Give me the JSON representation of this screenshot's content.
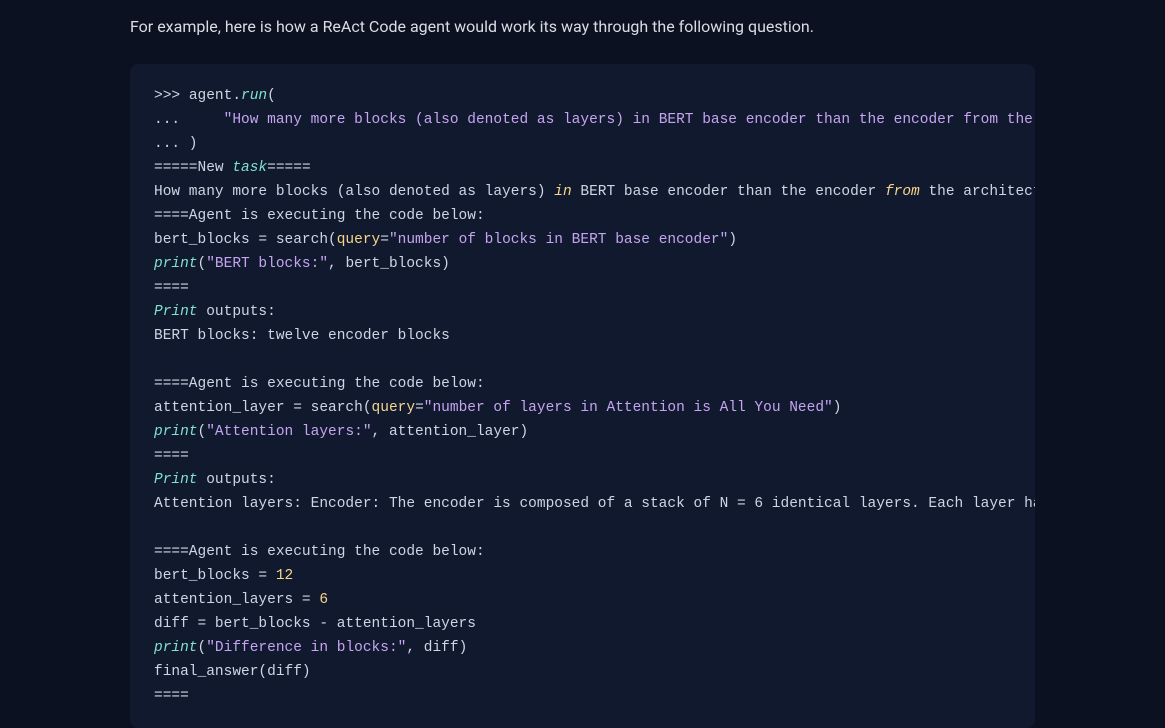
{
  "intro": "For example, here is how a ReAct Code agent would work its way through the following question.",
  "code": {
    "l1_prompt": ">>> ",
    "l1_agent": "agent.",
    "l1_run": "run",
    "l1_paren": "(",
    "l2_prompt": "...     ",
    "l2_str": "\"How many more blocks (also denoted as layers) in BERT base encoder than the encoder from the architecture proposed in Attention is All You Need?\"",
    "l3": "... )",
    "l4_a": "=====New ",
    "l4_task": "task",
    "l4_c": "=====",
    "l5_a": "How many more blocks (also denoted as layers) ",
    "l5_in": "in",
    "l5_b": " BERT base encoder than the encoder ",
    "l5_from": "from",
    "l5_c": " the architecture proposed in Attention is All You Need?",
    "l6": "====Agent is executing the code below:",
    "l7_a": "bert_blocks = search(",
    "l7_q": "query",
    "l7_eq": "=",
    "l7_str": "\"number of blocks in BERT base encoder\"",
    "l7_b": ")",
    "l8_print": "print",
    "l8_a": "(",
    "l8_str": "\"BERT blocks:\"",
    "l8_b": ", bert_blocks)",
    "l9": "====",
    "l10_print": "Print",
    "l10_a": " outputs:",
    "l11": "BERT blocks: twelve encoder blocks",
    "blank": "",
    "l13": "====Agent is executing the code below:",
    "l14_a": "attention_layer = search(",
    "l14_q": "query",
    "l14_eq": "=",
    "l14_str": "\"number of layers in Attention is All You Need\"",
    "l14_b": ")",
    "l15_print": "print",
    "l15_a": "(",
    "l15_str": "\"Attention layers:\"",
    "l15_b": ", attention_layer)",
    "l16": "====",
    "l17_print": "Print",
    "l17_a": " outputs:",
    "l18": "Attention layers: Encoder: The encoder is composed of a stack of N = 6 identical layers. Each layer has two sub-layers.",
    "l20": "====Agent is executing the code below:",
    "l21_a": "bert_blocks = ",
    "l21_n": "12",
    "l22_a": "attention_layers = ",
    "l22_n": "6",
    "l23": "diff = bert_blocks - attention_layers",
    "l24_print": "print",
    "l24_a": "(",
    "l24_str": "\"Difference in blocks:\"",
    "l24_b": ", diff)",
    "l25": "final_answer(diff)",
    "l26": "===="
  }
}
